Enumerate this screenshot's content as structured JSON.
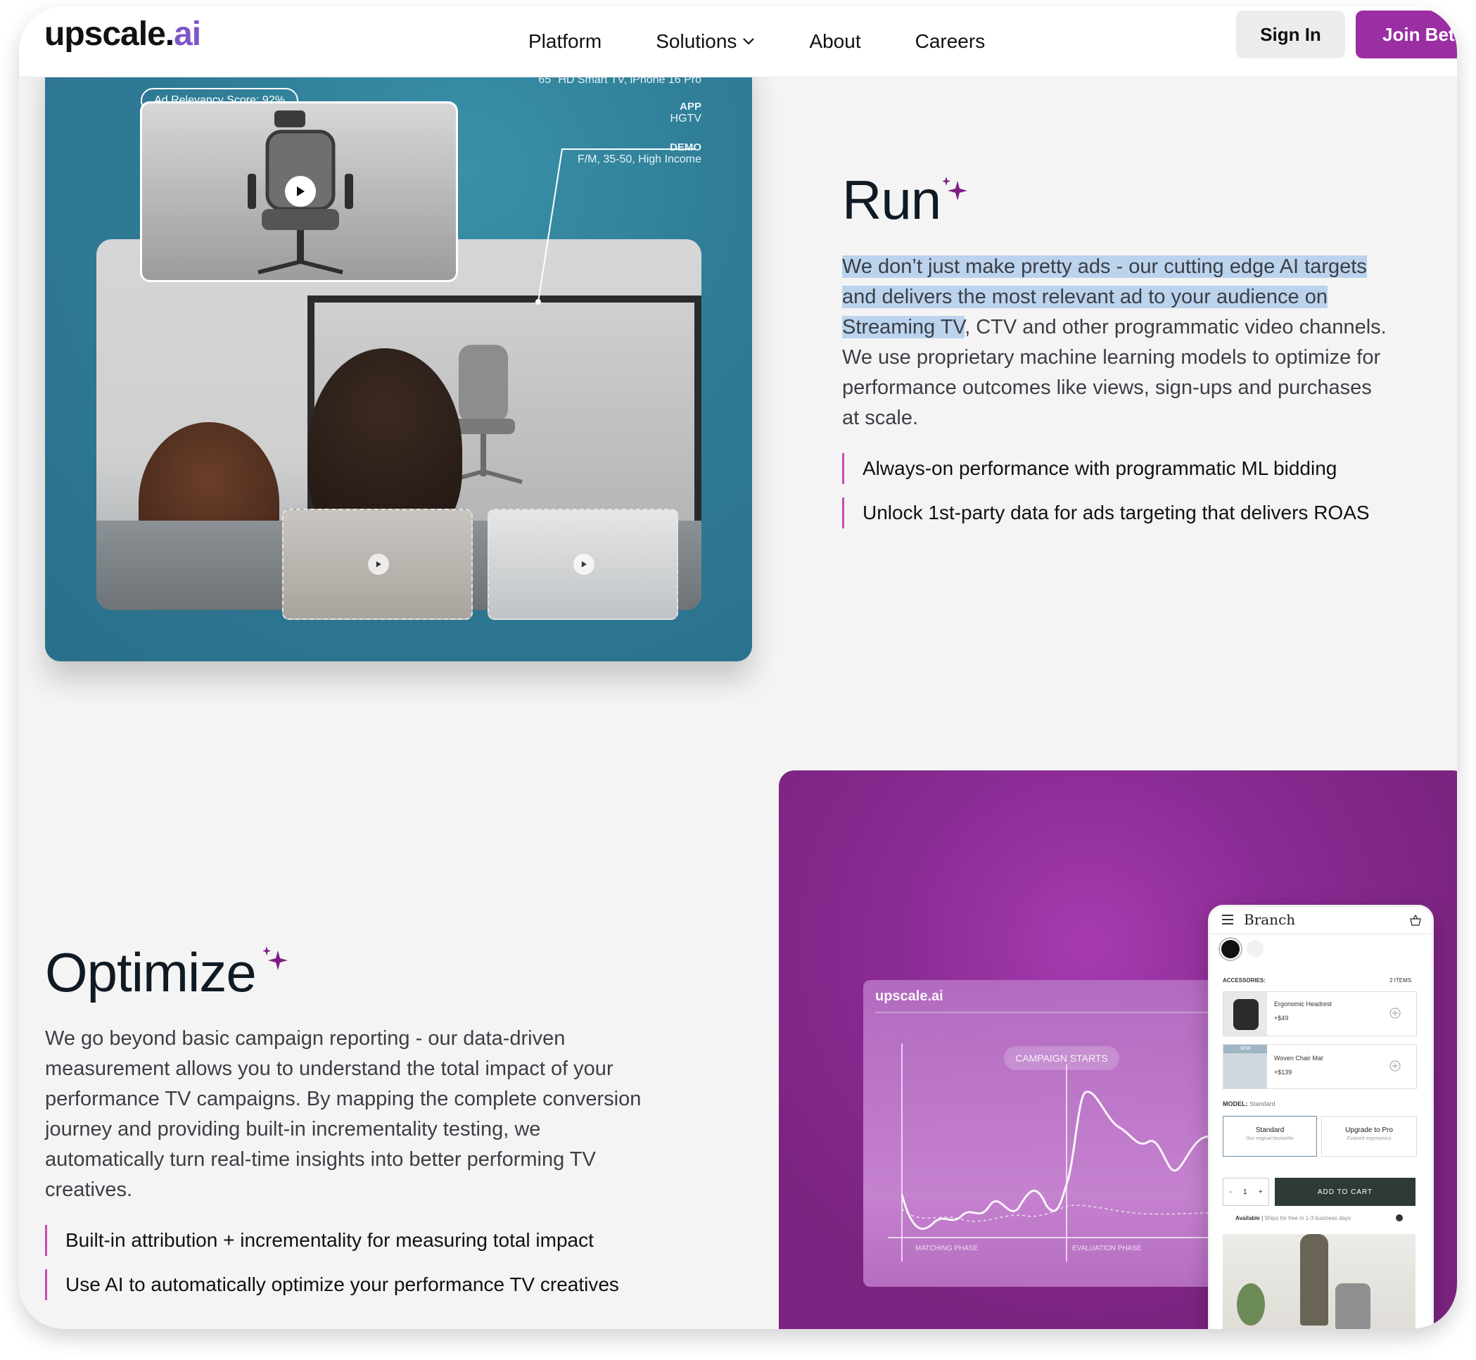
{
  "header": {
    "logo_main": "upscale.",
    "logo_ai": "ai",
    "nav": [
      "Platform",
      "Solutions",
      "About",
      "Careers"
    ],
    "sign_in": "Sign In",
    "join": "Join Beta"
  },
  "run": {
    "meta_device_value": "65\" HD Smart TV, iPhone 16 Pro",
    "meta_app_key": "APP",
    "meta_app_value": "HGTV",
    "meta_demo_key": "DEMO",
    "meta_demo_value": "F/M, 35-50, High Income",
    "badge": "Ad Relevancy Score: 92%",
    "title": "Run",
    "para_highlight": "We don’t just make pretty ads - our cutting edge AI targets and delivers the most relevant ad to your audience on Streaming TV",
    "para_rest": ", CTV and other programmatic video channels. We use proprietary machine learning models to optimize for performance outcomes like views, sign-ups and purchases at scale.",
    "bullets": [
      "Always-on performance with programmatic ML bidding",
      "Unlock 1st-party data for ads targeting that delivers ROAS"
    ]
  },
  "optimize": {
    "title": "Optimize",
    "para": "We go beyond basic campaign reporting - our data-driven measurement allows you to understand the total impact of your performance TV campaigns.  By mapping the complete conversion journey and providing built-in incrementality testing, we automatically turn real-time insights into better performing TV creatives.",
    "bullets": [
      "Built-in attribution + incrementality for measuring total impact",
      "Use AI to automatically optimize your performance TV creatives"
    ]
  },
  "chart_widget": {
    "logo": "upscale.ai",
    "pill": "CAMPAIGN STARTS",
    "phase1": "MATCHING PHASE",
    "phase2": "EVALUATION PHASE"
  },
  "phone": {
    "title": "Branch",
    "accessories_label": "ACCESSORIES:",
    "items_count": "2 ITEMS",
    "item1_name": "Ergonomic Headrest",
    "item1_price": "+$49",
    "item2_badge": "NEW",
    "item2_name": "Woven Chair Mat",
    "item2_price": "+$139",
    "model_label": "MODEL:",
    "model_value": "Standard",
    "opt1_title": "Standard",
    "opt1_sub": "Our original bestseller",
    "opt2_title": "Upgrade to Pro",
    "opt2_sub": "Evolved ergonomics",
    "qty": "1",
    "minus": "-",
    "plus": "+",
    "add_to_cart": "ADD TO CART",
    "available": "Available",
    "ships": "Ships for free in 1-3 business days"
  },
  "colors": {
    "accent": "#9b2ea3",
    "teal_card": "#2f7d97",
    "purple_card": "#7b2380",
    "bullet_bar": "#c94bb3",
    "highlight": "#bcd3ee"
  }
}
